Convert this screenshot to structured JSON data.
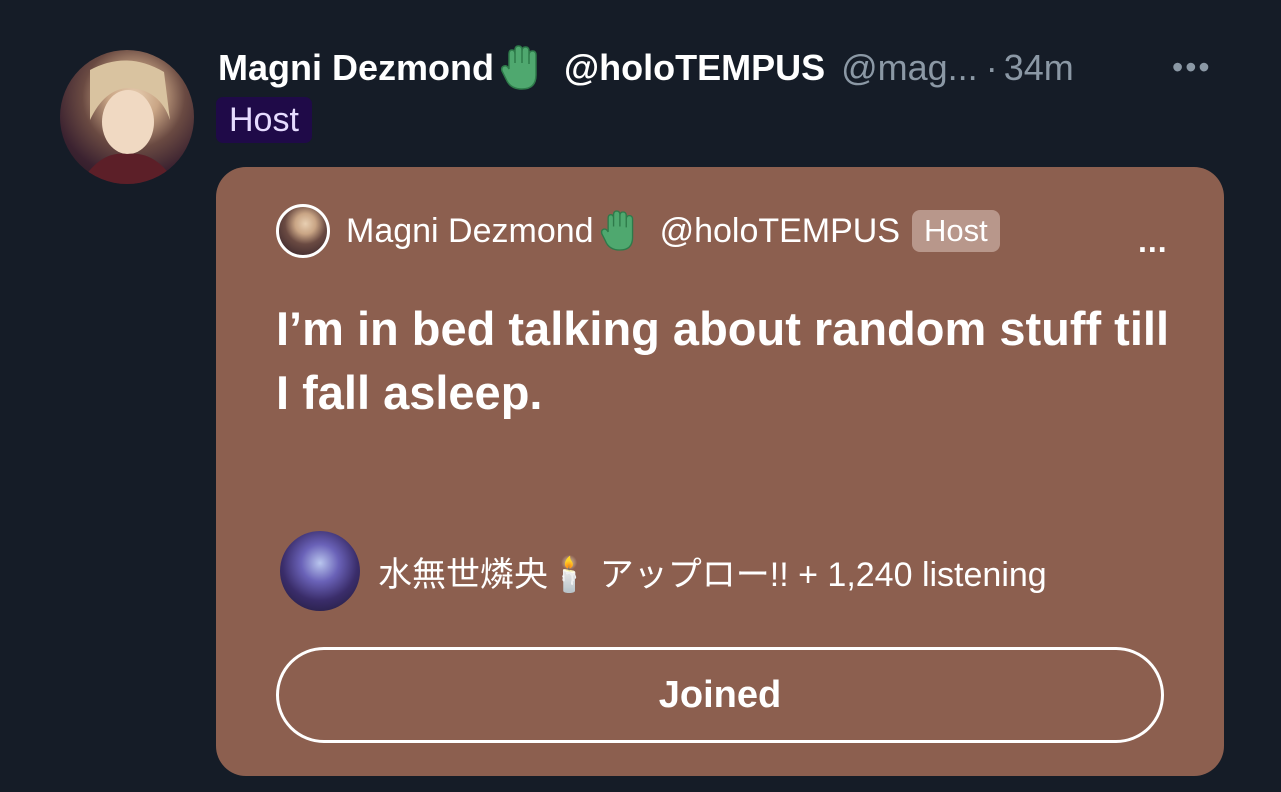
{
  "post": {
    "author_name": "Magni Dezmond",
    "name_emoji_icon": "green-glove-icon",
    "affiliation_handle": "@holoTEMPUS",
    "handle": "@mag...",
    "separator": "·",
    "time": "34m",
    "more": "•••",
    "role_badge": "Host"
  },
  "space_card": {
    "host_name": "Magni Dezmond",
    "host_affiliation": "@holoTEMPUS",
    "role_badge": "Host",
    "more": "...",
    "title": "I’m in bed talking about random stuff till I fall asleep.",
    "listeners_text": "水無世燐央🕯️ アップロー!! + 1,240 listening",
    "action_button": "Joined"
  },
  "colors": {
    "background": "#151c27",
    "card": "#8c5f4f",
    "host_badge_bg": "#1f0a48",
    "muted_text": "#8b98a5"
  }
}
